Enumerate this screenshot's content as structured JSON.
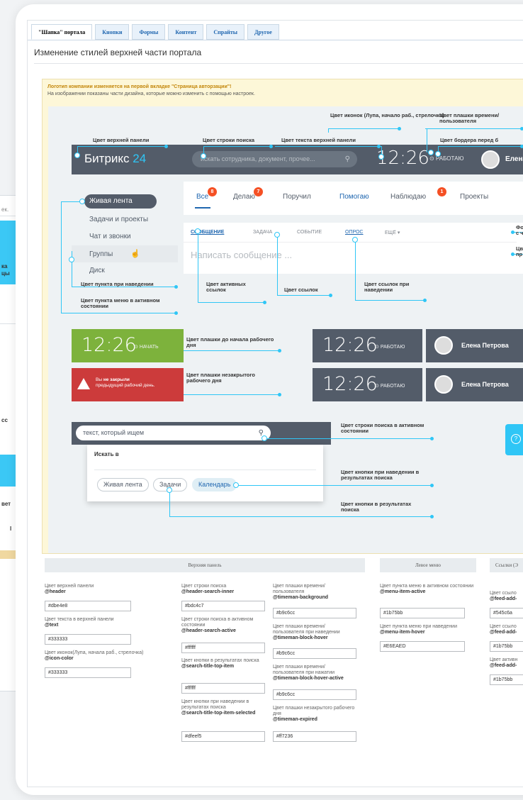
{
  "background_window": {
    "snippets": [
      "ек.",
      "ка",
      "цы",
      "сс",
      "вет",
      "l"
    ]
  },
  "tabs": [
    {
      "label": "\"Шапка\" портала",
      "active": true
    },
    {
      "label": "Кнопки"
    },
    {
      "label": "Формы"
    },
    {
      "label": "Контент"
    },
    {
      "label": "Спрайты"
    },
    {
      "label": "Другое"
    }
  ],
  "page_title": "Изменение стилей верхней части портала",
  "notes": {
    "warning": "Логотип компании изменяется на первой вкладке \"Страница авторзации\"!",
    "info": "На изображении показаны части дизайна, которые можно изменить с помощью настроек."
  },
  "header": {
    "logo_main": "Битрикс",
    "logo_num": "24",
    "search_placeholder": "искать сотрудника, документ, прочее...",
    "clock": "12:26",
    "work_status": "РАБОТАЮ",
    "user_name": "Елена"
  },
  "left_menu": [
    "Живая лента",
    "Задачи и проекты",
    "Чат и звонки",
    "Группы",
    "Диск"
  ],
  "feed_tabs": [
    {
      "label": "Все",
      "badge": "8"
    },
    {
      "label": "Делаю",
      "badge": "7"
    },
    {
      "label": "Поручил"
    },
    {
      "label": "Помогаю"
    },
    {
      "label": "Наблюдаю",
      "badge": "1"
    },
    {
      "label": "Проекты"
    }
  ],
  "post_tabs": [
    "Сообщение",
    "Задача",
    "Событие",
    "Опрос",
    "Ещё ▾"
  ],
  "post_placeholder": "Написать сообщение ...",
  "timeman": {
    "clock": "12:26",
    "start": "НАЧАТЬ",
    "work": "РАБОТАЮ",
    "expired_1": "Вы",
    "expired_bold": "не закрыли",
    "expired_2": "предыдущий рабочий день.",
    "user": "Елена Петрова"
  },
  "search_demo": {
    "value": "текст, который ищем",
    "heading": "Искать в",
    "chips": [
      "Живая лента",
      "Задачи",
      "Календарь"
    ]
  },
  "annotations": {
    "icon_color": "Цвет иконок (Лупа, начало раб., стрелочка)",
    "time_bg": "Цвет плашки времени/пользователя",
    "header_bg": "Цвет верхней панели",
    "search_row": "Цвет строки поиска",
    "header_text": "Цвет текста верхней панели",
    "border": "Цвет бордера перед б",
    "side_f": "Фо с ч",
    "side_c": "Цв пр",
    "menu_hover": "Цвет пункта при наведении",
    "menu_active": "Цвет пункта меню в активном состоянии",
    "active_links": "Цвет активных ссылок",
    "links": "Цвет ссылок",
    "links_hover": "Цвет ссылок при наведении",
    "before_start": "Цвет плашки до начала рабочего дня",
    "not_closed": "Цвет плашки незакрытого рабочего дня",
    "search_active": "Цвет строки поиска в активном состоянии",
    "btn_hover": "Цвет кнопки при наведении в результатах поиска",
    "btn": "Цвет кнопки в результатах поиска"
  },
  "sections": {
    "top_panel": "Верхняя панель",
    "left_menu": "Левое меню",
    "links": "Ссылки (Э"
  },
  "fields": {
    "col1": [
      {
        "label": "Цвет верхней панели",
        "var": "@header",
        "value": "#dbe4e8"
      },
      {
        "label": "Цвет текста в верхней панели",
        "var": "@text",
        "value": "#333333"
      },
      {
        "label": "Цвет иконок(Лупа, начала раб., стрелочка)",
        "var": "@icon-color",
        "value": "#333333"
      }
    ],
    "col2": [
      {
        "label": "Цвет строки поиска",
        "var": "@header-search-inner",
        "value": "#bdc4c7"
      },
      {
        "label": "Цвет строки поиска в активном состоянии",
        "var": "@header-search-active",
        "value": "#ffffff"
      },
      {
        "label": "Цвет кнопки в результатах поиска",
        "var": "@search-title-top-item",
        "value": "#ffffff"
      },
      {
        "label": "Цвет кнопки при наведении в результатах поиска",
        "var": "@search-title-top-item-selected",
        "value": "#dfeef5"
      }
    ],
    "col3": [
      {
        "label": "Цвет плашки времени/ пользователя",
        "var": "@timeman-background",
        "value": "#b9c6cc"
      },
      {
        "label": "Цвет плашки времени/ пользователя при наведении",
        "var": "@timeman-block-hover",
        "value": "#b9c6cc"
      },
      {
        "label": "Цвет плашки времени/ пользователя при нажатии",
        "var": "@timeman-block-hover-active",
        "value": "#b9c6cc"
      },
      {
        "label": "Цвет плашки незакрытого рабочего дня",
        "var": "@timeman-expired",
        "value": "#ff7236"
      }
    ],
    "col4": [
      {
        "label": "Цвет пункта меню в активном состоянии",
        "var": "@menu-item-active",
        "value": "#1b75bb"
      },
      {
        "label": "Цвет пункта меню при наведении",
        "var": "@menu-item-hover",
        "value": "#E6EAED"
      }
    ],
    "col5": [
      {
        "label": "Цвет ссыло",
        "var": "@feed-add-",
        "value": "#545c6a"
      },
      {
        "label": "Цвет ссыло",
        "var": "@feed-add-",
        "value": "#1b75bb"
      },
      {
        "label": "Цвет активн",
        "var": "@feed-add-",
        "value": "#1b75bb"
      }
    ]
  },
  "colors": {
    "accent": "#2fc6f6",
    "header": "#535c69",
    "link": "#2067b0",
    "green": "#7db23c",
    "red": "#cc3b3b"
  }
}
